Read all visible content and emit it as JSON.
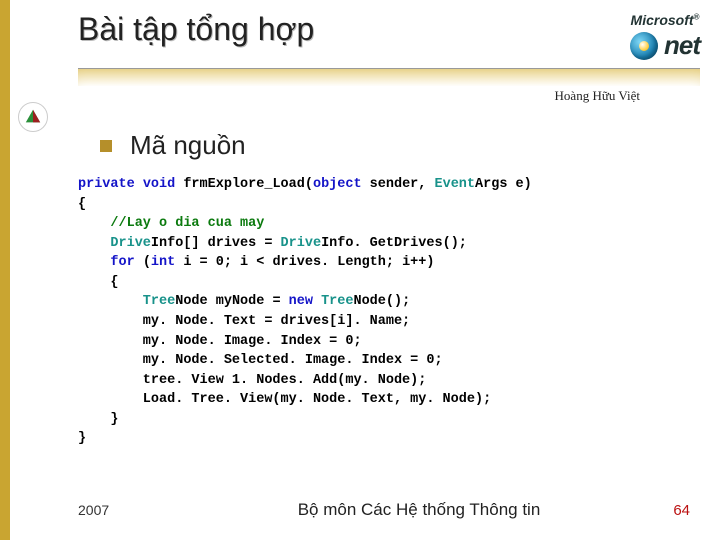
{
  "header": {
    "title": "Bài tập tổng hợp",
    "logo": {
      "top_text": "Microsoft",
      "net_text": "net"
    },
    "author": "Hoàng Hữu Việt"
  },
  "subheading": "Mã nguồn",
  "code": {
    "l0a": "private",
    "l0b": " void",
    "l0c": " frm",
    "l0d": "Explore_Load(",
    "l0e": "object",
    "l0f": " sender, ",
    "l0g": "Event",
    "l0h": "Args e)",
    "l1": "{",
    "l2": "    //Lay o dia cua may",
    "l3a": "    Drive",
    "l3b": "Info[] drives = ",
    "l3c": "Drive",
    "l3d": "Info. Get",
    "l3e": "Drives();",
    "l4a": "    for",
    "l4b": " (",
    "l4c": "int",
    "l4d": " i = 0; i < drives. Length; i++)",
    "l5": "    {",
    "l6a": "        Tree",
    "l6b": "Node my",
    "l6c": "Node = ",
    "l6d": "new",
    "l6e": " Tree",
    "l6f": "Node();",
    "l7": "        my. Node. Text = drives[i]. Name;",
    "l8": "        my. Node. Image. Index = 0;",
    "l9": "        my. Node. Selected. Image. Index = 0;",
    "l10": "        tree. View 1. Nodes. Add(my. Node);",
    "l11": "        Load. Tree. View(my. Node. Text, my. Node);",
    "l12": "    }",
    "l13": "}"
  },
  "footer": {
    "year": "2007",
    "department": "Bộ môn Các Hệ thống Thông tin",
    "page": "64"
  }
}
